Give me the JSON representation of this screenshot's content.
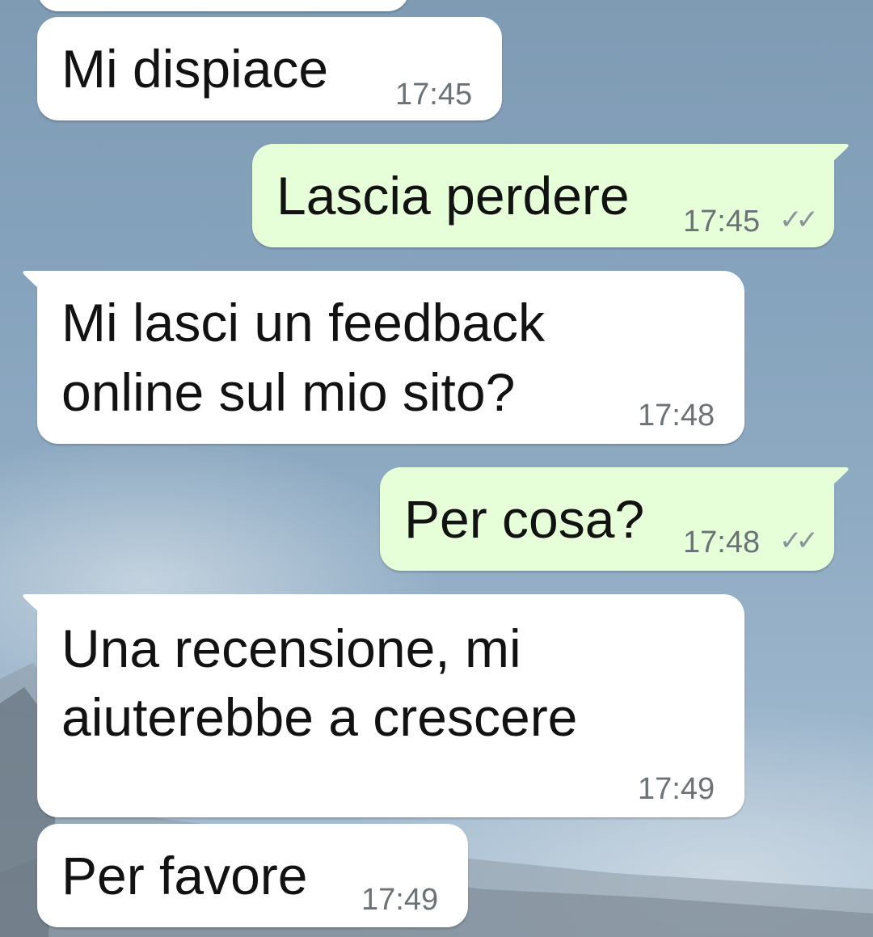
{
  "messages": [
    {
      "id": "m1",
      "direction": "incoming",
      "text": [
        "Mi dispiace"
      ],
      "time": "17:45"
    },
    {
      "id": "m2",
      "direction": "outgoing",
      "text": [
        "Lascia perdere"
      ],
      "time": "17:45",
      "status_icon": "double-check-icon",
      "status_glyph": "✓✓"
    },
    {
      "id": "m3",
      "direction": "incoming",
      "text": [
        "Mi lasci un feedback",
        "online sul mio sito?"
      ],
      "time": "17:48"
    },
    {
      "id": "m4",
      "direction": "outgoing",
      "text": [
        "Per cosa?"
      ],
      "time": "17:48",
      "status_icon": "double-check-icon",
      "status_glyph": "✓✓"
    },
    {
      "id": "m5",
      "direction": "incoming",
      "text": [
        "Una recensione, mi",
        "aiuterebbe a crescere"
      ],
      "time": "17:49"
    },
    {
      "id": "m6",
      "direction": "incoming",
      "text": [
        "Per favore"
      ],
      "time": "17:49"
    }
  ],
  "colors": {
    "incoming_bubble": "#ffffff",
    "outgoing_bubble": "#e6ffd9",
    "timestamp": "#6b7378"
  }
}
